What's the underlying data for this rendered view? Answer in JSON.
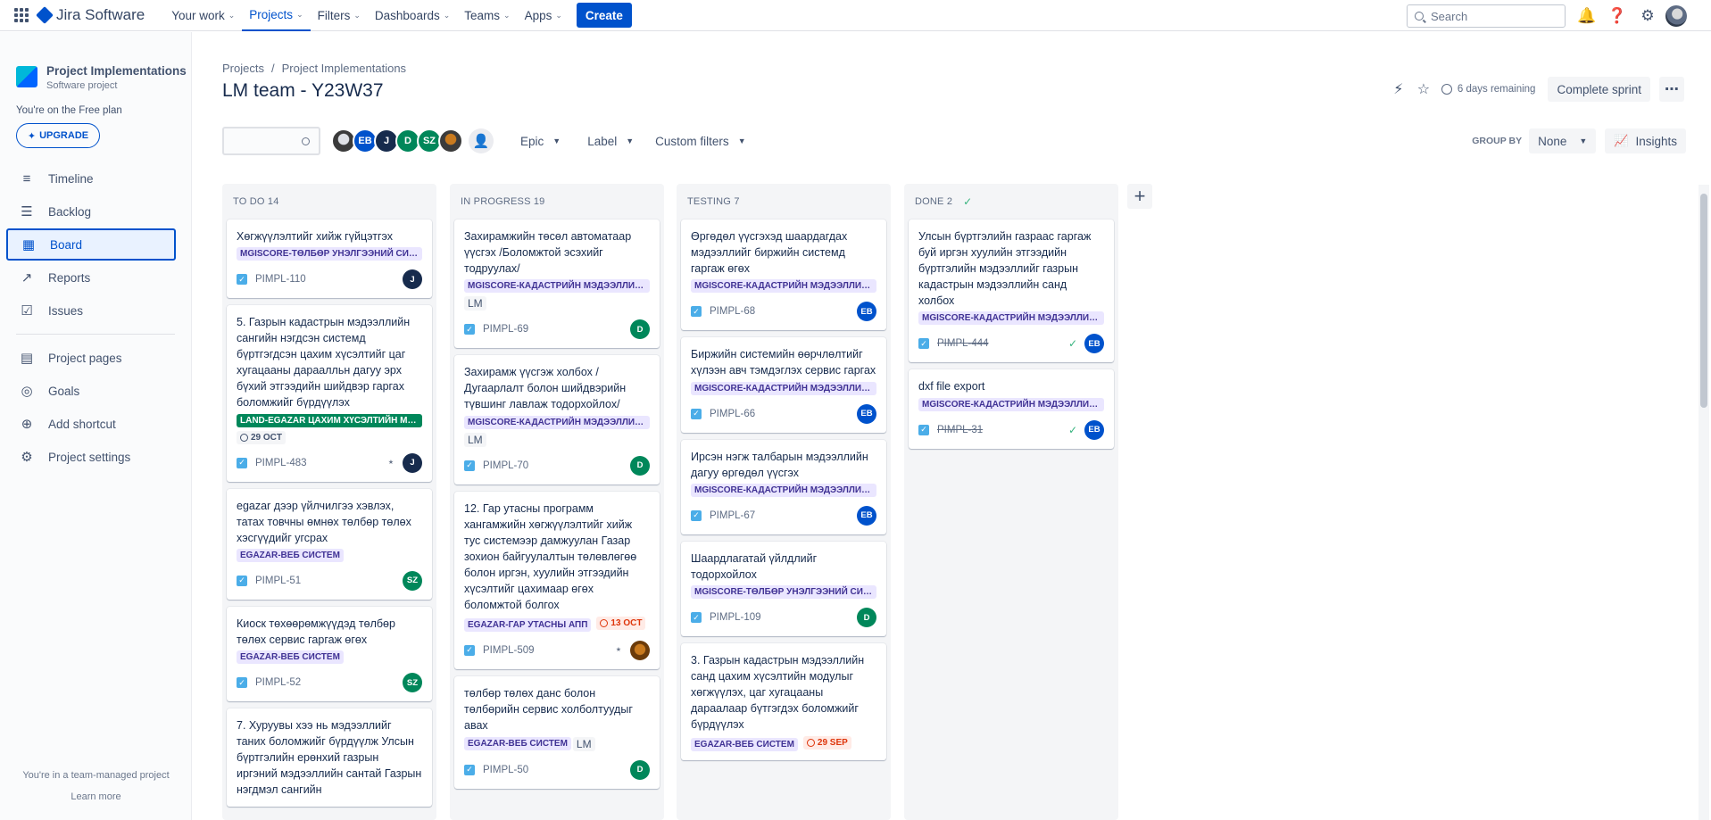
{
  "nav": {
    "product": "Jira Software",
    "menu": [
      {
        "label": "Your work",
        "active": false
      },
      {
        "label": "Projects",
        "active": true
      },
      {
        "label": "Filters",
        "active": false
      },
      {
        "label": "Dashboards",
        "active": false
      },
      {
        "label": "Teams",
        "active": false
      },
      {
        "label": "Apps",
        "active": false
      }
    ],
    "create_label": "Create",
    "search_placeholder": "Search"
  },
  "sidebar": {
    "project_name": "Project Implementations",
    "project_type": "Software project",
    "plan_text": "You're on the Free plan",
    "upgrade_label": "UPGRADE",
    "items": [
      {
        "label": "Timeline",
        "icon": "timeline-icon"
      },
      {
        "label": "Backlog",
        "icon": "backlog-icon"
      },
      {
        "label": "Board",
        "icon": "board-icon",
        "active": true
      },
      {
        "label": "Reports",
        "icon": "reports-icon"
      },
      {
        "label": "Issues",
        "icon": "issues-icon"
      }
    ],
    "items2": [
      {
        "label": "Project pages",
        "icon": "pages-icon"
      },
      {
        "label": "Goals",
        "icon": "goals-icon"
      },
      {
        "label": "Add shortcut",
        "icon": "add-shortcut-icon"
      },
      {
        "label": "Project settings",
        "icon": "settings-icon"
      }
    ],
    "footer_text": "You're in a team-managed project",
    "learn_more": "Learn more"
  },
  "header": {
    "breadcrumb": [
      "Projects",
      "Project Implementations"
    ],
    "title": "LM team - Y23W37",
    "remaining": "6 days remaining",
    "complete_sprint": "Complete sprint"
  },
  "filters": {
    "members": [
      {
        "initials": "",
        "color": "#5e6c84",
        "photo": true
      },
      {
        "initials": "EB",
        "color": "#0052cc"
      },
      {
        "initials": "J",
        "color": "#172b4d"
      },
      {
        "initials": "D",
        "color": "#00875a"
      },
      {
        "initials": "SZ",
        "color": "#00875a"
      },
      {
        "initials": "",
        "color": "#c97a1e",
        "photo": true
      }
    ],
    "epic": "Epic",
    "label": "Label",
    "custom": "Custom filters",
    "group_by_label": "GROUP BY",
    "group_by_value": "None",
    "insights": "Insights"
  },
  "columns": [
    {
      "title": "TO DO 14",
      "cards": [
        {
          "title": "Хөгжүүлэлтийг хийж гүйцэтгэх",
          "epic": "MGISCORE-ТӨЛБӨР УНЭЛГЭЭНИЙ СИСТ...",
          "key": "PIMPL-110",
          "assignee": "J",
          "color": "#172b4d"
        },
        {
          "title": "5. Газрын кадастрын мэдээллийн сангийн нэгдсэн системд бүртгэгдсэн цахим хүсэлтийг цаг хугацааны дараалльн дагуу эрх бүхий этгээдийн шийдвэр гаргах боломжийг бүрдүүлэх",
          "epic": "LAND-EGAZAR ЦАХИМ ХҮСЭЛТИЙН МО...",
          "epic_style": "green",
          "due": "29 OCT",
          "due_style": "gray",
          "key": "PIMPL-483",
          "assignee": "J",
          "color": "#172b4d",
          "hierarchy": true
        },
        {
          "title": "egazar дээр үйлчилгээ хэвлэх, татах товчны өмнөх төлбөр төлөх хэсгүүдийг угсрах",
          "epic": "EGAZAR-ВЕБ СИСТЕМ",
          "key": "PIMPL-51",
          "assignee": "SZ",
          "color": "#00875a"
        },
        {
          "title": "Киоск төхөөрөмжүүдэд төлбөр төлөх сервис гаргаж өгөх",
          "epic": "EGAZAR-ВЕБ СИСТЕМ",
          "key": "PIMPL-52",
          "assignee": "SZ",
          "color": "#00875a"
        },
        {
          "title": "7. Хуруувы хээ нь мэдээллийг таних боломжийг бүрдүүлж Улсын бүртгэлийн ерөнхий газрын иргэний мэдээллийн сантай Газрын нэгдмэл сангийн",
          "epic": "",
          "key": "",
          "assignee": "",
          "color": "#172b4d"
        }
      ]
    },
    {
      "title": "IN PROGRESS 19",
      "cards": [
        {
          "title": "Захирамжийн төсөл автоматаар үүсгэх /Боломжтой эсэхийг тодруулах/",
          "epic": "MGISCORE-КАДАСТРИЙН МЭДЭЭЛЛИЙ...",
          "label": "LM",
          "key": "PIMPL-69",
          "assignee": "D",
          "color": "#00875a"
        },
        {
          "title": "Захирамж үүсгэж холбох / Дугаарлалт болон шийдвэрийн түвшинг лавлаж тодорхойлох/",
          "epic": "MGISCORE-КАДАСТРИЙН МЭДЭЭЛЛИЙ...",
          "label": "LM",
          "key": "PIMPL-70",
          "assignee": "D",
          "color": "#00875a"
        },
        {
          "title": "12. Гар утасны программ хангамжийн хөгжүүлэлтийг хийж тус системээр дамжуулан Газар зохион байгуулалтын төлөвлөгөө болон иргэн, хуулийн этгээдийн хүсэлтийг цахимаар өгөх боломжтой болгох",
          "epic": "EGAZAR-ГАР УТАСНЫ АПП",
          "due": "13 OCT",
          "due_style": "red",
          "key": "PIMPL-509",
          "assignee": "",
          "color": "#c97a1e",
          "photo": true,
          "hierarchy": true
        },
        {
          "title": "төлбөр төлөх данс болон төлбөрийн сервис холболтуудыг авах",
          "epic": "EGAZAR-ВЕБ СИСТЕМ",
          "label": "LM",
          "label_inline": true,
          "key": "PIMPL-50",
          "assignee": "D",
          "color": "#00875a"
        }
      ]
    },
    {
      "title": "TESTING 7",
      "cards": [
        {
          "title": "Өргөдөл үүсгэхэд шаардагдах мэдээллийг биржийн системд гаргаж өгөх",
          "epic": "MGISCORE-КАДАСТРИЙН МЭДЭЭЛЛИЙ...",
          "key": "PIMPL-68",
          "assignee": "EB",
          "color": "#0052cc"
        },
        {
          "title": "Биржийн системийн өөрчлөлтийг хүлээн авч тэмдэглэх сервис гаргах",
          "epic": "MGISCORE-КАДАСТРИЙН МЭДЭЭЛЛИЙ...",
          "key": "PIMPL-66",
          "assignee": "EB",
          "color": "#0052cc"
        },
        {
          "title": "Ирсэн нэгж талбарын мэдээллийн дагуу өргөдөл үүсгэх",
          "epic": "MGISCORE-КАДАСТРИЙН МЭДЭЭЛЛИЙ...",
          "key": "PIMPL-67",
          "assignee": "EB",
          "color": "#0052cc"
        },
        {
          "title": "Шаардлагатай үйлдлийг тодорхойлох",
          "epic": "MGISCORE-ТӨЛБӨР УНЭЛГЭЭНИЙ СИСТ...",
          "key": "PIMPL-109",
          "assignee": "D",
          "color": "#00875a"
        },
        {
          "title": "3. Газрын кадастрын мэдээллийн санд цахим хүсэлтийн модулыг хөгжүүлэх, цаг хугацааны дараалаар бүтгэгдэх боломжийг бүрдүүлэх",
          "epic": "EGAZAR-ВЕБ СИСТЕМ",
          "due": "29 SEP",
          "due_style": "red",
          "due_inline": true,
          "key": "",
          "assignee": "",
          "color": "#172b4d"
        }
      ]
    },
    {
      "title": "DONE 2",
      "done": true,
      "cards": [
        {
          "title": "Улсын бүртгэлийн газраас гаргаж буй иргэн хуулийн этгээдийн бүртгэлийн мэдээллийг газрын кадастрын мэдээллийн санд холбох",
          "epic": "MGISCORE-КАДАСТРИЙН МЭДЭЭЛЛИЙ...",
          "key": "PIMPL-444",
          "strike": true,
          "assignee": "EB",
          "color": "#0052cc"
        },
        {
          "title": "dxf file export",
          "epic": "MGISCORE-КАДАСТРИЙН МЭДЭЭЛЛИЙ...",
          "key": "PIMPL-31",
          "strike": true,
          "assignee": "EB",
          "color": "#0052cc"
        }
      ]
    }
  ]
}
